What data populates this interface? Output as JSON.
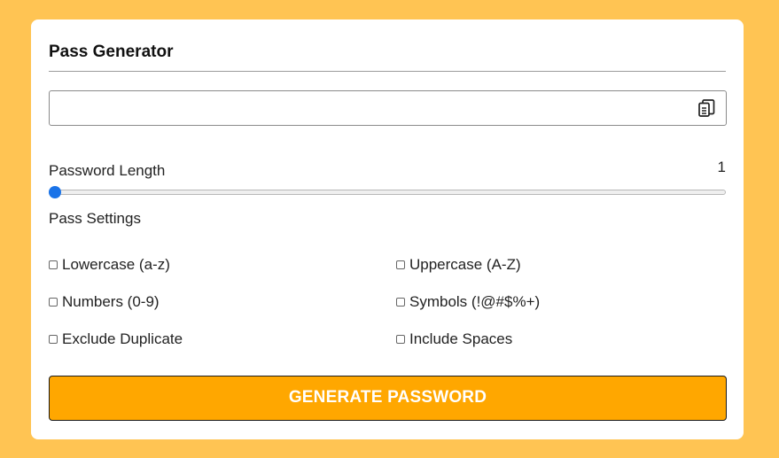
{
  "card": {
    "title": "Pass Generator"
  },
  "output": {
    "value": "",
    "copy_icon": "copy-icon"
  },
  "length": {
    "label": "Password Length",
    "value": "1",
    "slider_min": 1,
    "slider_max": 30,
    "slider_value": 1
  },
  "settings": {
    "label": "Pass Settings",
    "options": [
      {
        "label": "Lowercase (a-z)",
        "checked": false
      },
      {
        "label": "Uppercase (A-Z)",
        "checked": false
      },
      {
        "label": "Numbers (0-9)",
        "checked": false
      },
      {
        "label": "Symbols (!@#$%+)",
        "checked": false
      },
      {
        "label": "Exclude Duplicate",
        "checked": false
      },
      {
        "label": "Include Spaces",
        "checked": false
      }
    ]
  },
  "button": {
    "label": "GENERATE PASSWORD"
  },
  "colors": {
    "background": "#ffc453",
    "button": "#ffa700",
    "slider_thumb": "#1a73e8"
  }
}
